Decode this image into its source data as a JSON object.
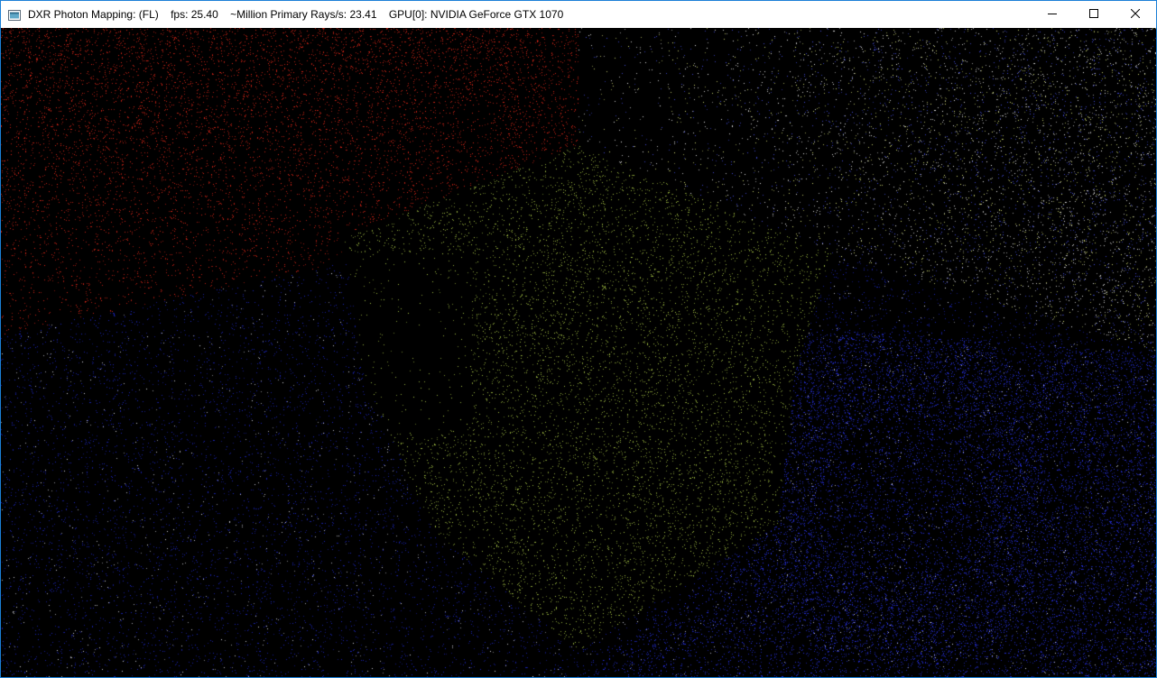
{
  "window": {
    "title": "DXR Photon Mapping: (FL)    fps: 25.40    ~Million Primary Rays/s: 23.41    GPU[0]: NVIDIA GeForce GTX 1070",
    "border_color": "#1b7fd6",
    "controls": {
      "minimize_icon": "minimize-icon",
      "maximize_icon": "maximize-icon",
      "close_icon": "close-icon"
    }
  },
  "scene": {
    "description_colors": {
      "left_wall": "#ff2a1a",
      "right_wall": "#2a3cff",
      "floor": "#2a3cff",
      "cube": "#c8e04a",
      "ceiling_right": "#ffffff",
      "background": "#000000"
    }
  }
}
